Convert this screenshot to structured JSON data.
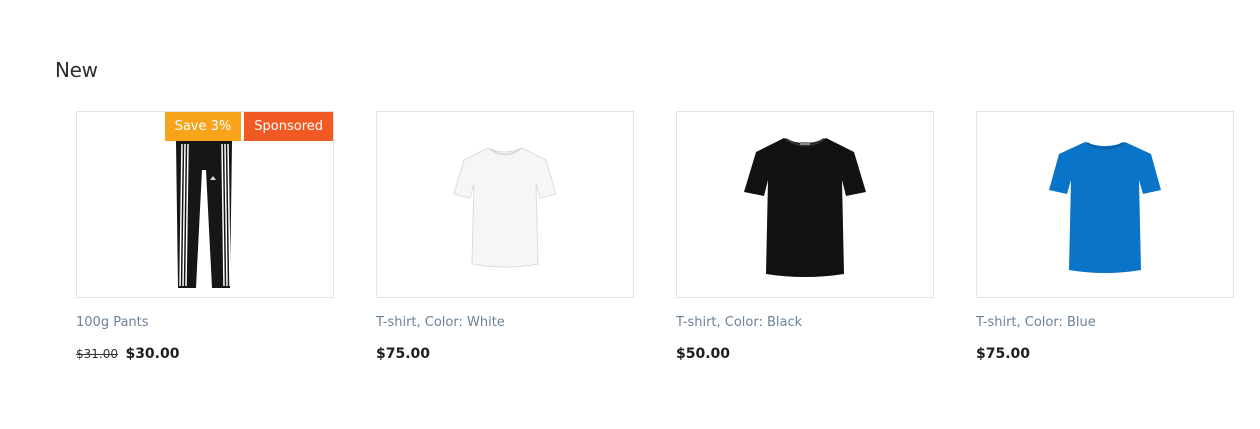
{
  "section": {
    "title": "New"
  },
  "products": [
    {
      "name": "100g Pants",
      "old_price": "$31.00",
      "price": "$30.00",
      "badges": {
        "save": "Save 3%",
        "sponsored": "Sponsored"
      },
      "image": "track-pants-black"
    },
    {
      "name": "T-shirt, Color: White",
      "price": "$75.00",
      "image": "tshirt-white",
      "color": "#f4f4f4"
    },
    {
      "name": "T-shirt, Color: Black",
      "price": "$50.00",
      "image": "tshirt-black",
      "color": "#111111"
    },
    {
      "name": "T-shirt, Color: Blue",
      "price": "$75.00",
      "image": "tshirt-blue",
      "color": "#0a74c9"
    }
  ],
  "colors": {
    "save_badge": "#f7a31c",
    "sponsored_badge": "#f15a22",
    "product_link": "#6b8299"
  }
}
